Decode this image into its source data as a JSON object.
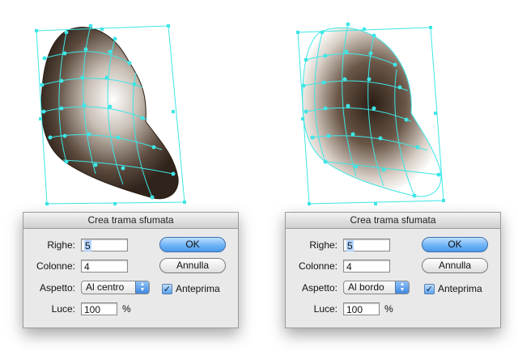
{
  "dialogs": [
    {
      "title": "Crea trama sfumata",
      "rows_label": "Righe:",
      "rows_value": "5",
      "cols_label": "Colonne:",
      "cols_value": "4",
      "aspect_label": "Aspetto:",
      "aspect_value": "Al centro",
      "light_label": "Luce:",
      "light_value": "100",
      "light_unit": "%",
      "ok_label": "OK",
      "cancel_label": "Annulla",
      "preview_label": "Anteprima",
      "preview_checked": true
    },
    {
      "title": "Crea trama sfumata",
      "rows_label": "Righe:",
      "rows_value": "5",
      "cols_label": "Colonne:",
      "cols_value": "4",
      "aspect_label": "Aspetto:",
      "aspect_value": "Al bordo",
      "light_label": "Luce:",
      "light_value": "100",
      "light_unit": "%",
      "ok_label": "OK",
      "cancel_label": "Annulla",
      "preview_label": "Anteprima",
      "preview_checked": true
    }
  ],
  "colors": {
    "mesh_line": "#3ee6e6",
    "dark_fill": "#3a2c22",
    "light_fill": "#ffffff"
  }
}
